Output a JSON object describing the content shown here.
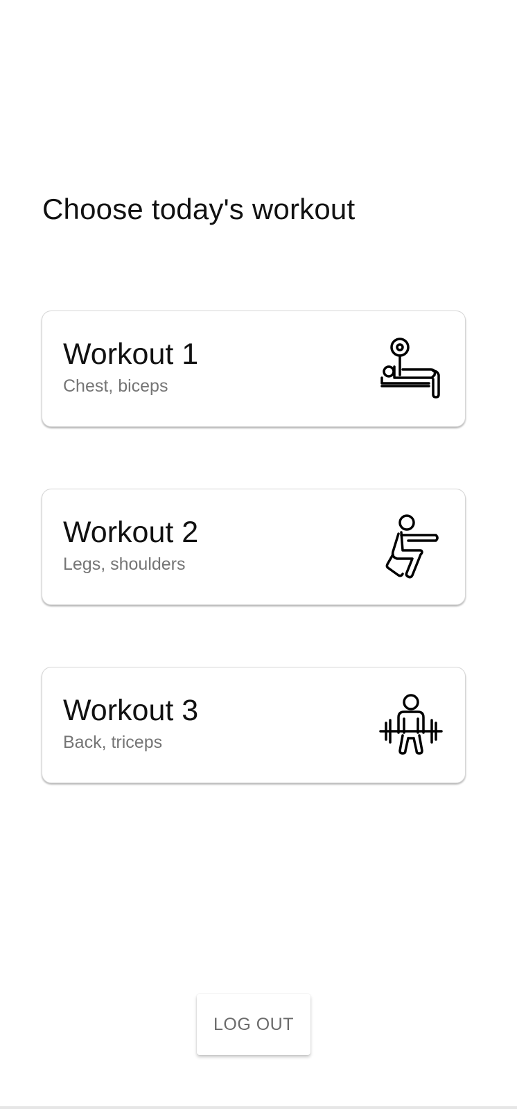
{
  "page": {
    "title": "Choose today's workout"
  },
  "workouts": [
    {
      "title": "Workout 1",
      "subtitle": "Chest, biceps",
      "icon": "bench-press-icon"
    },
    {
      "title": "Workout 2",
      "subtitle": "Legs, shoulders",
      "icon": "squat-icon"
    },
    {
      "title": "Workout 3",
      "subtitle": "Back, triceps",
      "icon": "deadlift-icon"
    }
  ],
  "actions": {
    "logout_label": "LOG OUT"
  },
  "colors": {
    "background": "#ffffff",
    "title_text": "#111111",
    "subtitle_text": "#757575",
    "card_border": "#d6d6d6",
    "button_text": "#6b6b6b"
  }
}
